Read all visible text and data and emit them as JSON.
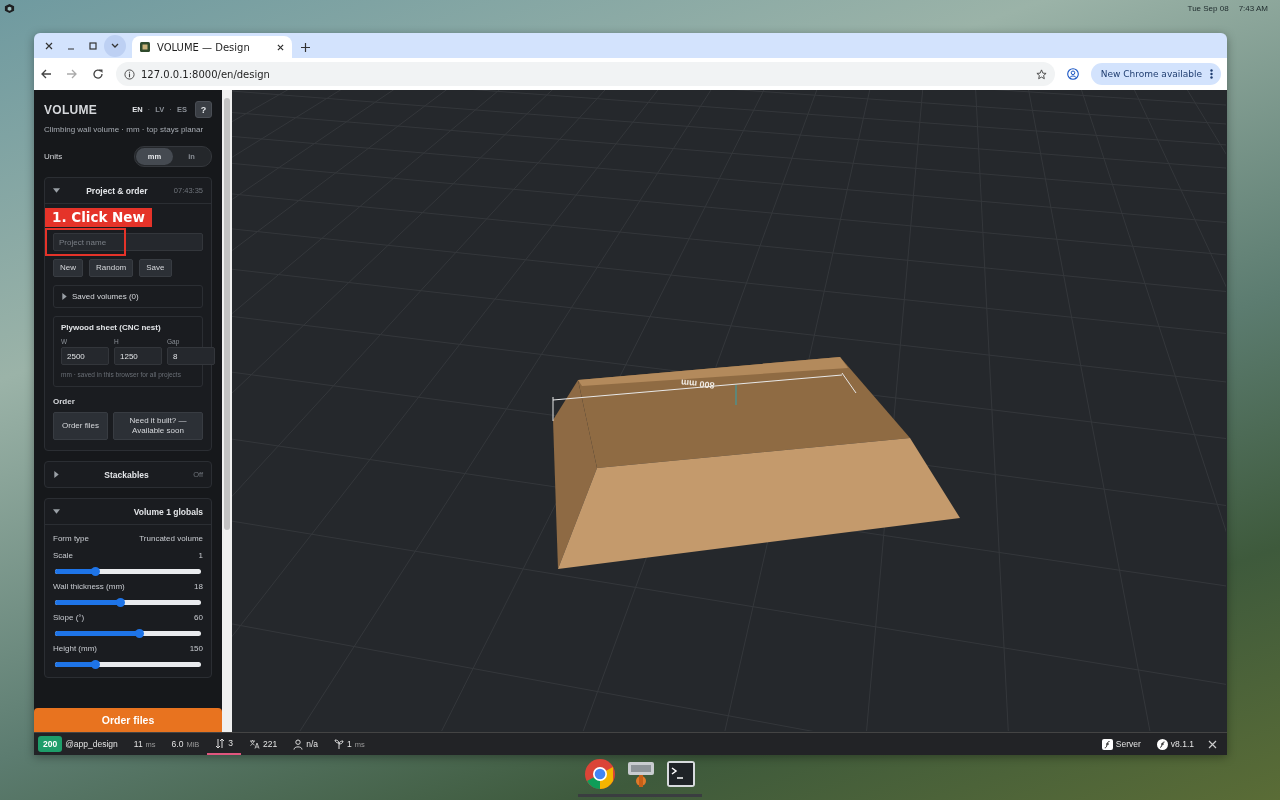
{
  "top_bar": {
    "date": "Tue Sep 08",
    "time": "7:43 AM"
  },
  "browser": {
    "tab_title": "VOLUME — Design",
    "url": "127.0.0.1:8000/en/design",
    "update_button": "New Chrome available"
  },
  "sidebar": {
    "title": "VOLUME",
    "languages": [
      {
        "label": "EN",
        "selected": true
      },
      {
        "label": "LV",
        "selected": false
      },
      {
        "label": "ES",
        "selected": false
      }
    ],
    "language_separator": "·",
    "help": "?",
    "subtitle": "Climbing wall volume · mm · top stays planar",
    "units_label": "Units",
    "units": [
      {
        "label": "mm",
        "selected": true
      },
      {
        "label": "in",
        "selected": false
      }
    ],
    "project": {
      "title": "Project & order",
      "time": "07:43:35",
      "expanded": true,
      "callout": "1. Click New",
      "name_placeholder": "Project name",
      "buttons": [
        "New",
        "Random",
        "Save"
      ],
      "saved": {
        "label": "Saved volumes (0)",
        "expanded": false
      },
      "sheet": {
        "title": "Plywood sheet (CNC nest)",
        "fields": [
          {
            "label": "W",
            "value": "2500"
          },
          {
            "label": "H",
            "value": "1250"
          },
          {
            "label": "Gap",
            "value": "8"
          }
        ],
        "note": "mm · saved in this browser for all projects"
      },
      "order_heading": "Order",
      "order_buttons": [
        "Order files",
        "Need it built? — Available soon"
      ]
    },
    "stackables": {
      "title": "Stackables",
      "status": "Off",
      "expanded": false
    },
    "globals": {
      "title": "Volume 1 globals",
      "expanded": true,
      "form_type": {
        "label": "Form type",
        "value": "Truncated volume"
      },
      "sliders": [
        {
          "label": "Scale",
          "reading": "1",
          "level": 0.28
        },
        {
          "label": "Wall thickness (mm)",
          "reading": "18",
          "level": 0.45
        },
        {
          "label": "Slope (°)",
          "reading": "60",
          "level": 0.58
        },
        {
          "label": "Height (mm)",
          "reading": "150",
          "level": 0.28
        }
      ]
    },
    "order_button": "Order files"
  },
  "viewport": {
    "dimension_label": "800 mm"
  },
  "debug_bar": {
    "status": "200",
    "route": "@app_design",
    "time": "11",
    "time_unit": "ms",
    "memory": "6.0",
    "memory_unit": "MiB",
    "requests": "3",
    "translations": "221",
    "user": "n/a",
    "load": "1",
    "load_unit": "ms",
    "server": "Server",
    "version": "v8.1.1"
  }
}
